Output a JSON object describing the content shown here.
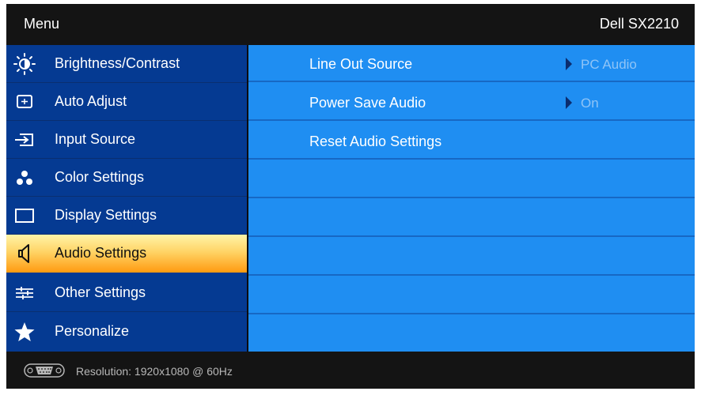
{
  "header": {
    "title": "Menu",
    "model": "Dell SX2210"
  },
  "menu": {
    "items": [
      {
        "label": "Brightness/Contrast",
        "icon": "brightness-icon"
      },
      {
        "label": "Auto Adjust",
        "icon": "auto-adjust-icon"
      },
      {
        "label": "Input Source",
        "icon": "input-source-icon"
      },
      {
        "label": "Color Settings",
        "icon": "color-settings-icon"
      },
      {
        "label": "Display Settings",
        "icon": "display-settings-icon"
      },
      {
        "label": "Audio Settings",
        "icon": "speaker-icon",
        "selected": true
      },
      {
        "label": "Other Settings",
        "icon": "sliders-icon"
      },
      {
        "label": "Personalize",
        "icon": "star-icon"
      }
    ]
  },
  "submenu": {
    "rows": [
      {
        "label": "Line Out Source",
        "value": "PC Audio"
      },
      {
        "label": "Power Save Audio",
        "value": "On"
      },
      {
        "label": "Reset Audio Settings",
        "value": ""
      }
    ]
  },
  "status": {
    "resolution": "Resolution: 1920x1080 @ 60Hz",
    "icon": "vga-connector-icon"
  },
  "colors": {
    "left_panel": "#053a92",
    "right_panel": "#1f8ef2",
    "selected_highlight": "#ffb733",
    "background": "#0d0d0d"
  }
}
